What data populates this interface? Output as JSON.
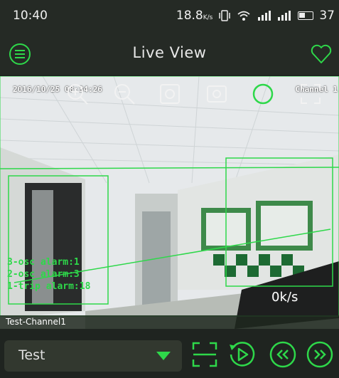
{
  "status_bar": {
    "time": "10:40",
    "network_speed": "18.8",
    "network_speed_unit": "K/s",
    "battery": "37"
  },
  "app_bar": {
    "title": "Live View",
    "menu_icon": "hamburger-menu-icon",
    "favorite_icon": "heart-icon"
  },
  "video": {
    "timestamp": "2016/10/25 08:34:26",
    "channel_osd": "Channel 1",
    "alarms": [
      "3-osc alarm:1",
      "2-osc alarm:3",
      "1-trip alarm:18"
    ],
    "bitrate": "0k/s",
    "channel_name": "Test-Channel1",
    "toolbar_icons": [
      "zoom-in-icon",
      "zoom-out-icon",
      "snapshot-icon",
      "record-icon",
      "ptz-icon",
      "fullscreen-icon"
    ]
  },
  "bottom_bar": {
    "device_select_value": "Test",
    "buttons": [
      "scan-icon",
      "playback-icon",
      "previous-icon",
      "next-icon"
    ]
  },
  "colors": {
    "accent": "#2ed84a",
    "bar_bg": "#252a25",
    "select_bg": "#32382f"
  }
}
